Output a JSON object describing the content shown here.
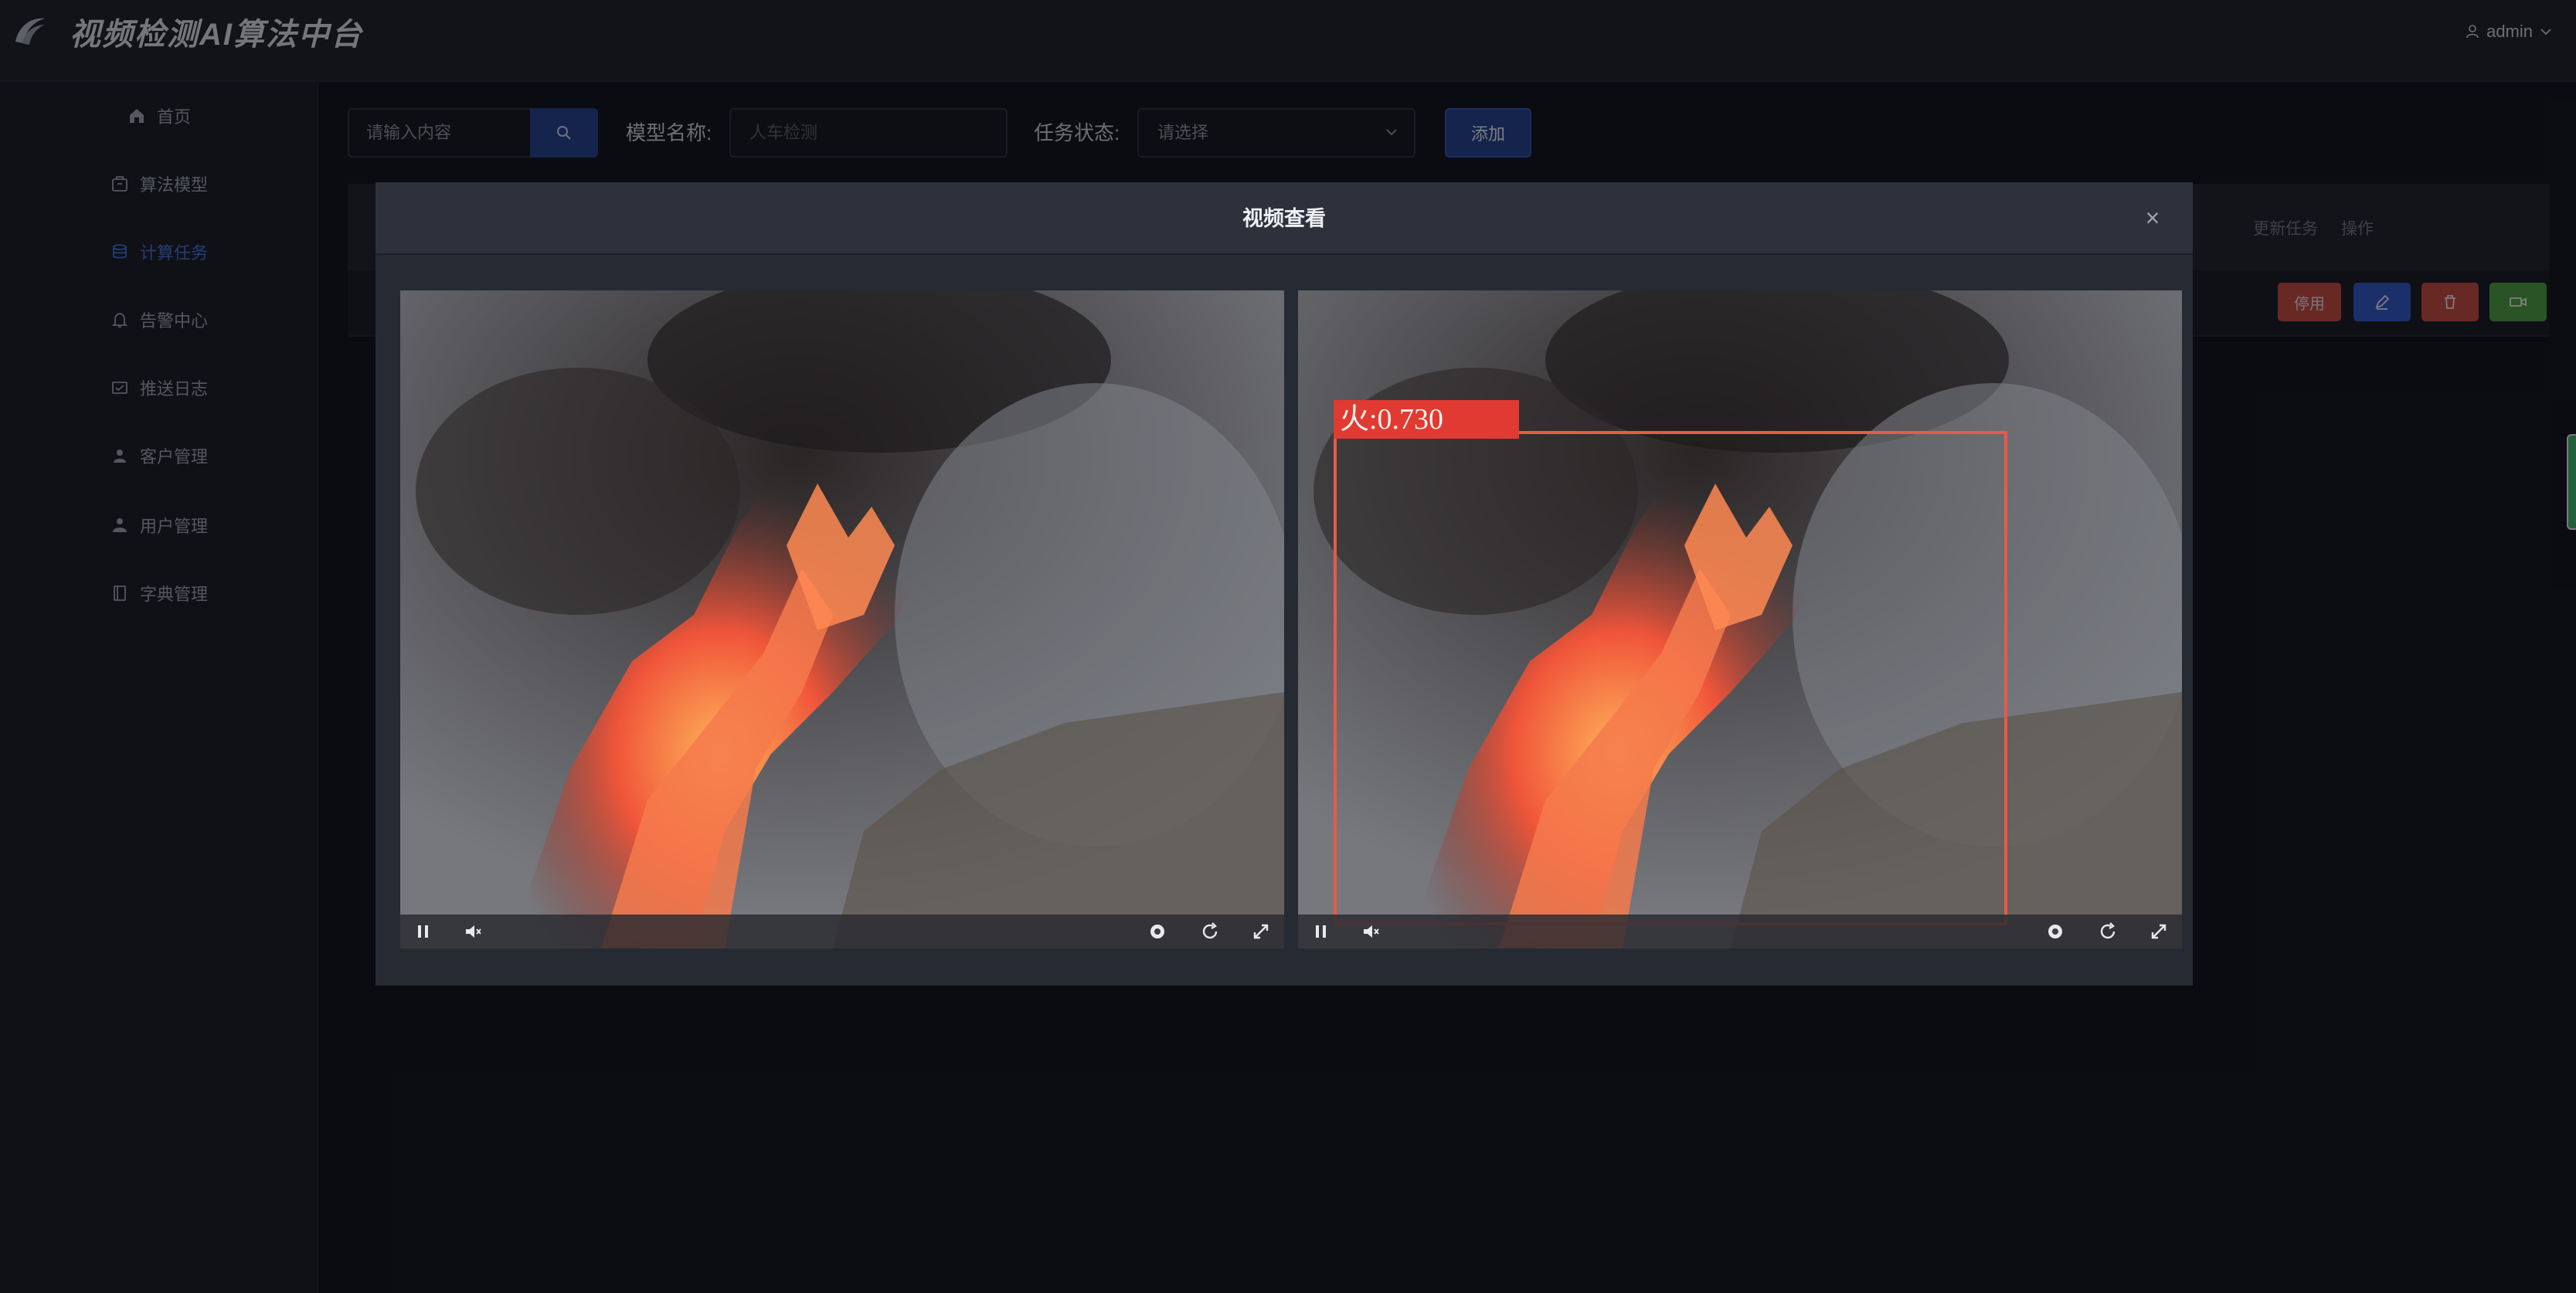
{
  "header": {
    "app_title": "视频检测AI算法中台",
    "user_name": "admin",
    "logo_icon": "swoosh-logo-icon"
  },
  "sidebar": {
    "items": [
      {
        "label": "首页",
        "icon": "home-icon"
      },
      {
        "label": "算法模型",
        "icon": "package-icon"
      },
      {
        "label": "计算任务",
        "icon": "database-icon",
        "active": true
      },
      {
        "label": "告警中心",
        "icon": "bell-icon"
      },
      {
        "label": "推送日志",
        "icon": "log-icon"
      },
      {
        "label": "客户管理",
        "icon": "customer-icon"
      },
      {
        "label": "用户管理",
        "icon": "user-icon"
      },
      {
        "label": "字典管理",
        "icon": "book-icon"
      }
    ]
  },
  "toolbar": {
    "search_placeholder": "请输入内容",
    "model_label": "模型名称:",
    "model_placeholder": "人车检测",
    "status_label": "任务状态:",
    "status_placeholder": "请选择",
    "add_label": "添加"
  },
  "table": {
    "headers": [
      "更新任务",
      "操作"
    ],
    "row_actions": {
      "disable_label": "停用"
    }
  },
  "modal": {
    "title": "视频查看",
    "close": "×",
    "detection_label": "火:0.730"
  },
  "colors": {
    "accent": "#1f3e86",
    "active_nav": "#3d6fd6",
    "danger": "#c0473c",
    "success": "#4c9a3f",
    "detection_box": "#e03a32"
  }
}
